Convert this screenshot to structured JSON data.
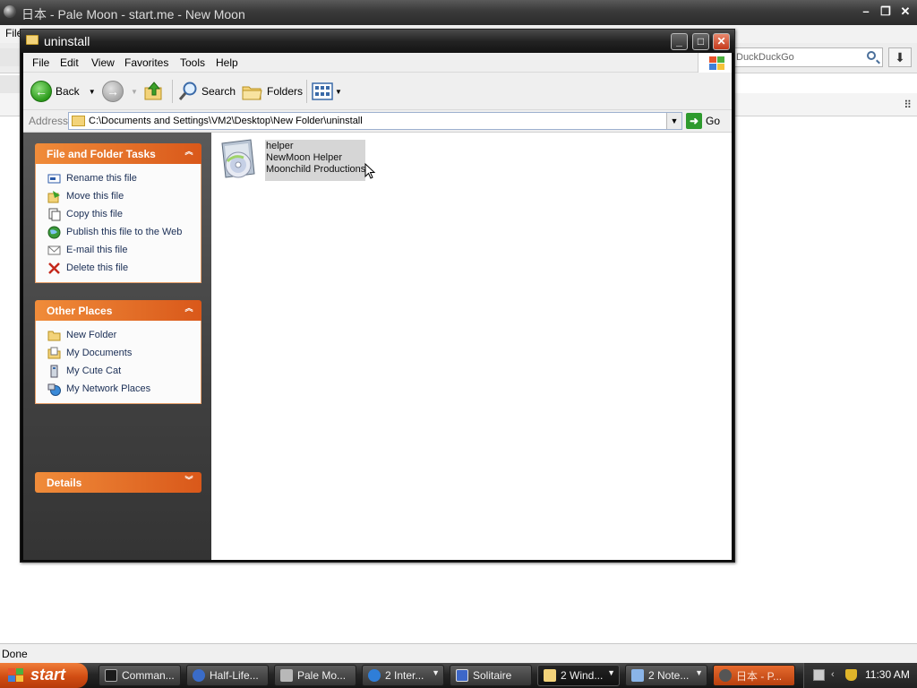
{
  "browser": {
    "title": "日本 - Pale Moon - start.me - New Moon",
    "menu_file": "File",
    "search_placeholder": "DuckDuckGo",
    "status": "Done"
  },
  "explorer": {
    "title": "uninstall",
    "menu": [
      "File",
      "Edit",
      "View",
      "Favorites",
      "Tools",
      "Help"
    ],
    "toolbar": {
      "back": "Back",
      "search": "Search",
      "folders": "Folders"
    },
    "address": {
      "label": "Address",
      "path": "C:\\Documents and Settings\\VM2\\Desktop\\New Folder\\uninstall",
      "go": "Go"
    },
    "tasks_panel": {
      "title": "File and Folder Tasks",
      "items": [
        {
          "label": "Rename this file",
          "icon": "rename-icon"
        },
        {
          "label": "Move this file",
          "icon": "move-icon"
        },
        {
          "label": "Copy this file",
          "icon": "copy-icon"
        },
        {
          "label": "Publish this file to the Web",
          "icon": "publish-web-icon"
        },
        {
          "label": "E-mail this file",
          "icon": "email-icon"
        },
        {
          "label": "Delete this file",
          "icon": "delete-icon"
        }
      ]
    },
    "places_panel": {
      "title": "Other Places",
      "items": [
        {
          "label": "New Folder",
          "icon": "folder-icon"
        },
        {
          "label": "My Documents",
          "icon": "my-documents-icon"
        },
        {
          "label": "My Cute Cat",
          "icon": "computer-icon"
        },
        {
          "label": "My Network Places",
          "icon": "network-places-icon"
        }
      ]
    },
    "details_panel": {
      "title": "Details"
    },
    "file": {
      "name": "helper",
      "description": "NewMoon Helper",
      "company": "Moonchild Productions"
    }
  },
  "taskbar": {
    "start": "start",
    "buttons": [
      {
        "label": "Comman...",
        "icon": "command-prompt-icon",
        "color": "#1b1b1b"
      },
      {
        "label": "Half-Life...",
        "icon": "steam-icon",
        "color": "#3a6cc9"
      },
      {
        "label": "Pale Mo...",
        "icon": "pale-moon-icon",
        "color": "#b8b8b8"
      },
      {
        "label": "2 Inter...",
        "icon": "internet-explorer-icon",
        "color": "#2f7ed8"
      },
      {
        "label": "Solitaire",
        "icon": "solitaire-icon",
        "color": "#3d67c8"
      },
      {
        "label": "2 Wind...",
        "icon": "folder-icon",
        "color": "#f3d37a"
      },
      {
        "label": "2 Note...",
        "icon": "notepad-icon",
        "color": "#8ab4e8"
      },
      {
        "label": "日本 - P...",
        "icon": "pale-moon-icon",
        "color": "#555555"
      }
    ],
    "clock": "11:30 AM"
  }
}
